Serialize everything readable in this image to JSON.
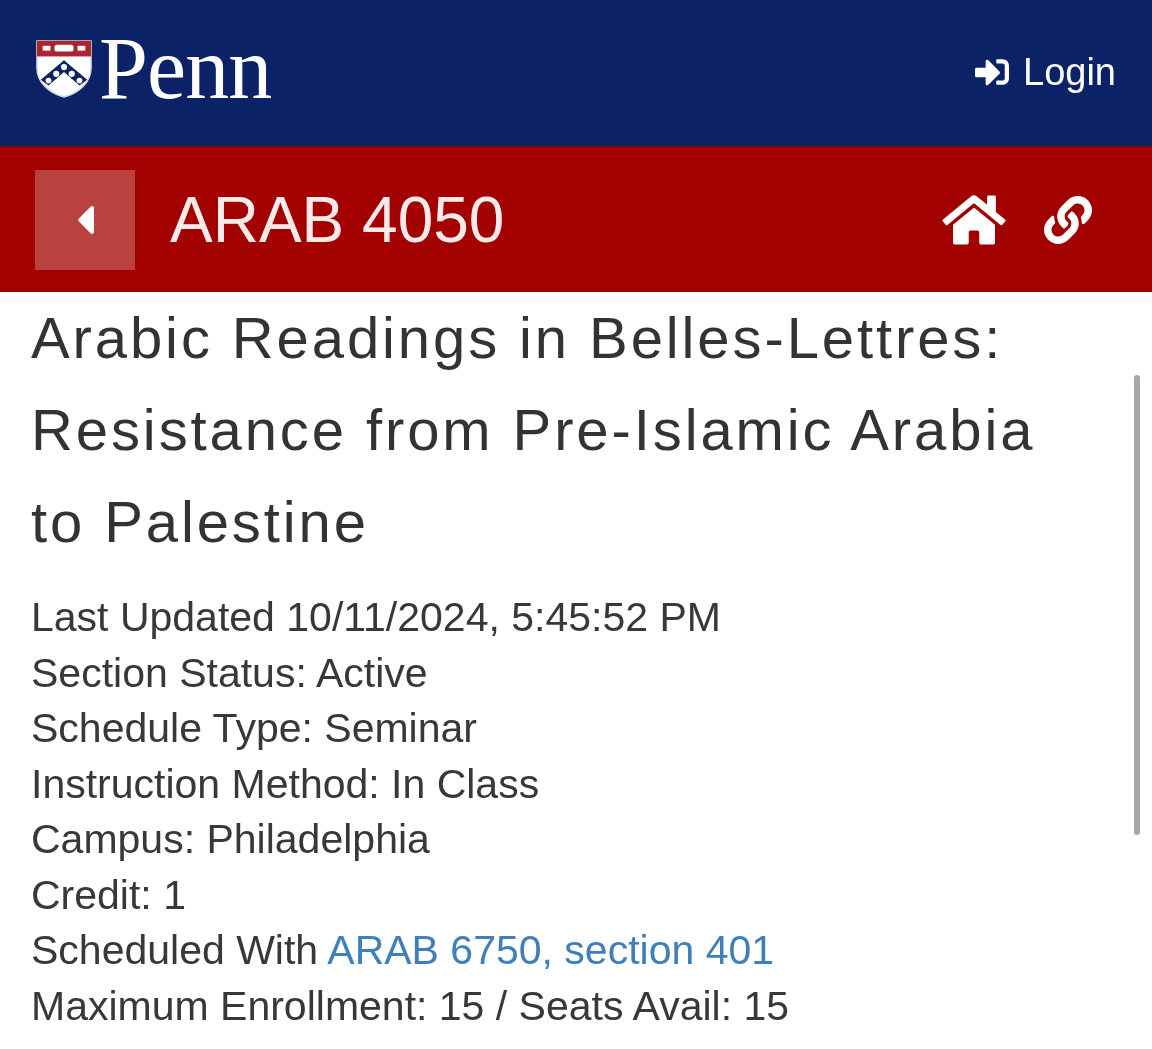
{
  "header": {
    "logo": "Penn",
    "login_button": "Login"
  },
  "course_bar": {
    "course_code": "ARAB 4050"
  },
  "title": "Arabic Readings in Belles-Lettres: Resistance from Pre-Islamic Arabia to Palestine",
  "details": [
    {
      "kind": "text",
      "text": "Last Updated 10/11/2024, 5:45:52 PM"
    },
    {
      "kind": "text",
      "text": "Section Status: Active"
    },
    {
      "kind": "text",
      "text": "Schedule Type: Seminar"
    },
    {
      "kind": "text",
      "text": "Instruction Method: In Class"
    },
    {
      "kind": "text",
      "text": "Campus: Philadelphia"
    },
    {
      "kind": "text",
      "text": "Credit: 1"
    },
    {
      "kind": "link",
      "text": "Scheduled With",
      "link": "ARAB 6750, section 401"
    },
    {
      "kind": "text",
      "text": "Maximum Enrollment: 15 / Seats Avail: 15"
    }
  ]
}
